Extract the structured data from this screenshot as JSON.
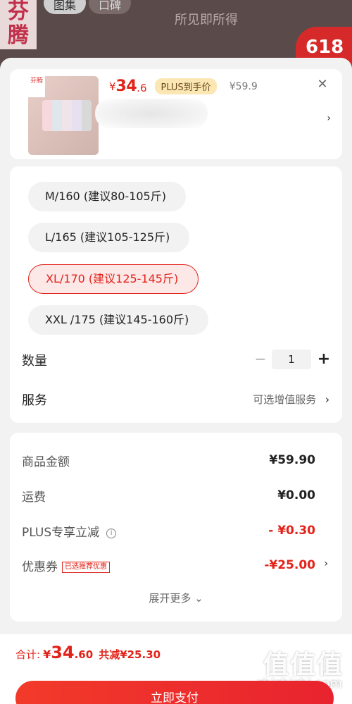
{
  "background": {
    "brand": "芬腾",
    "tabs": [
      "图集",
      "口碑"
    ],
    "subtitle": "所见即所得",
    "badge": "618"
  },
  "product": {
    "price_currency": "¥",
    "price_integer": "34",
    "price_decimal": ".6",
    "plus_tag": "PLUS到手价",
    "original_price": "¥59.9",
    "image_logo": "芬腾"
  },
  "sizes": [
    {
      "label": "M/160 (建议80-105斤)",
      "selected": false
    },
    {
      "label": "L/165 (建议105-125斤)",
      "selected": false
    },
    {
      "label": "XL/170 (建议125-145斤)",
      "selected": true
    },
    {
      "label": "XXL /175 (建议145-160斤)",
      "selected": false
    }
  ],
  "quantity": {
    "label": "数量",
    "value": "1",
    "minus": "−",
    "plus": "+"
  },
  "service": {
    "label": "服务",
    "link": "可选增值服务"
  },
  "fees": {
    "goods_amount_label": "商品金额",
    "goods_amount": "¥59.90",
    "shipping_label": "运费",
    "shipping": "¥0.00",
    "plus_discount_label": "PLUS专享立减",
    "plus_discount": "- ¥0.30",
    "coupon_label": "优惠券",
    "coupon_tag": "已选推荐优惠",
    "coupon": "-¥25.00",
    "more": "展开更多"
  },
  "footer": {
    "total_label": "合计:",
    "total_currency": "¥",
    "total_integer": "34",
    "total_decimal": ".60",
    "saved": "共减¥25.30",
    "pay_button": "立即支付",
    "watermark": "值值值",
    "watermark_url": "zhizhizhi.com"
  },
  "colors": {
    "accent": "#e2231a",
    "plus_tag_bg": "#fbe7b3"
  }
}
